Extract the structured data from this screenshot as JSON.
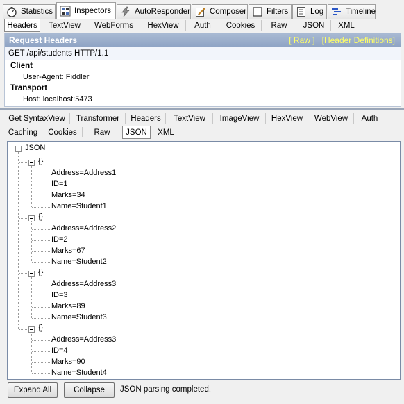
{
  "top_tabs": [
    {
      "label": "Statistics",
      "icon": "stopwatch-icon"
    },
    {
      "label": "Inspectors",
      "icon": "inspectors-icon",
      "active": true
    },
    {
      "label": "AutoResponder",
      "icon": "lightning-icon"
    },
    {
      "label": "Composer",
      "icon": "composer-icon"
    },
    {
      "label": "Filters",
      "icon": "checkbox-icon"
    },
    {
      "label": "Log",
      "icon": "log-icon"
    },
    {
      "label": "Timeline",
      "icon": "timeline-icon"
    }
  ],
  "request_tabs": [
    "Headers",
    "TextView",
    "WebForms",
    "HexView",
    "Auth",
    "Cookies",
    "Raw",
    "JSON",
    "XML"
  ],
  "request_active_tab": "Headers",
  "request_panel": {
    "title": "Request Headers",
    "raw_link": "[ Raw ]",
    "defs_link": "[Header Definitions]",
    "request_line": "GET /api/students HTTP/1.1",
    "groups": [
      {
        "name": "Client",
        "headers": [
          "User-Agent: Fiddler"
        ]
      },
      {
        "name": "Transport",
        "headers": [
          "Host: localhost:5473"
        ]
      }
    ]
  },
  "response_tabs_row1": [
    "Get SyntaxView",
    "Transformer",
    "Headers",
    "TextView",
    "ImageView",
    "HexView",
    "WebView",
    "Auth"
  ],
  "response_tabs_row2": [
    "Caching",
    "Cookies",
    "Raw",
    "JSON",
    "XML"
  ],
  "response_active_tab": "JSON",
  "tree": {
    "root": "JSON",
    "object_label": "{}",
    "objects": [
      [
        "Address=Address1",
        "ID=1",
        "Marks=34",
        "Name=Student1"
      ],
      [
        "Address=Address2",
        "ID=2",
        "Marks=67",
        "Name=Student2"
      ],
      [
        "Address=Address3",
        "ID=3",
        "Marks=89",
        "Name=Student3"
      ],
      [
        "Address=Address3",
        "ID=4",
        "Marks=90",
        "Name=Student4"
      ]
    ]
  },
  "bottom": {
    "expand_label": "Expand All",
    "collapse_label": "Collapse",
    "status": "JSON parsing completed."
  },
  "colors": {
    "header_bar": "#98abca",
    "header_link": "#ffff66",
    "panel_border": "#7a8ba6"
  }
}
